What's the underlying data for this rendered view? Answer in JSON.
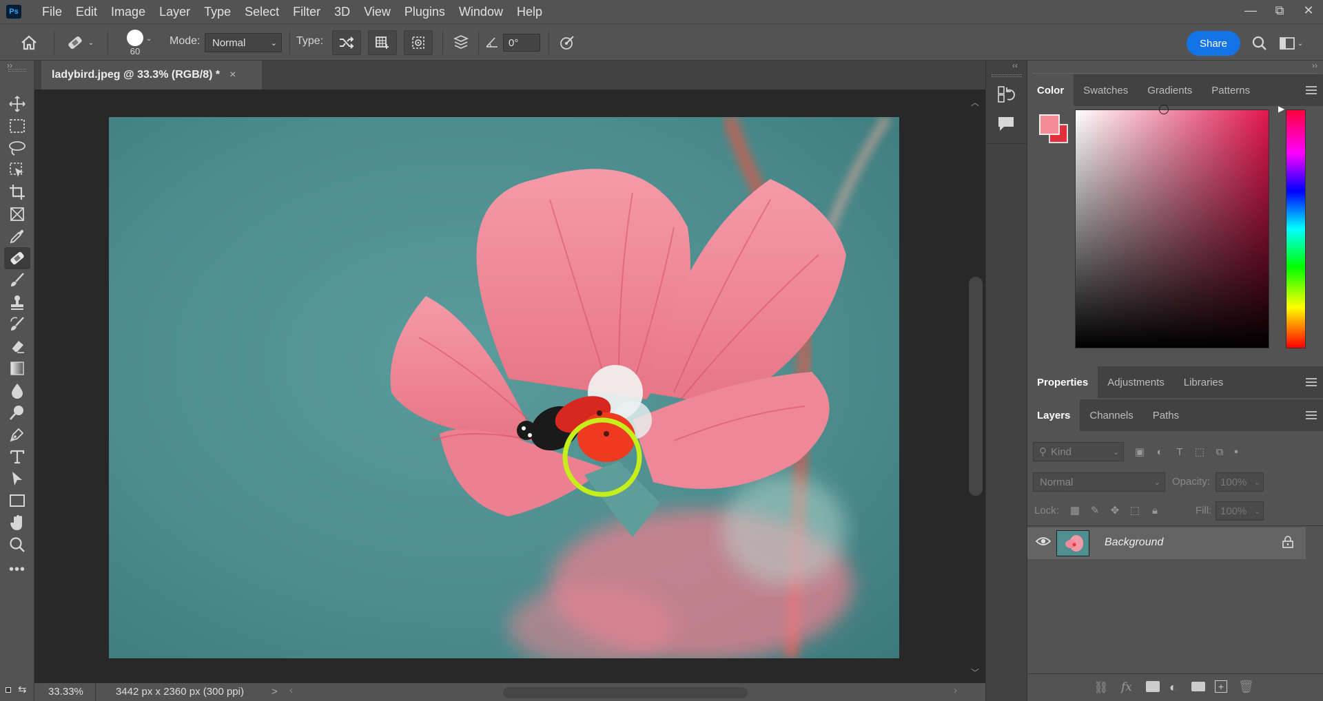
{
  "app": {
    "logo_text": "Ps"
  },
  "menu": [
    "File",
    "Edit",
    "Image",
    "Layer",
    "Type",
    "Select",
    "Filter",
    "3D",
    "View",
    "Plugins",
    "Window",
    "Help"
  ],
  "window_controls": {
    "minimize": "—",
    "restore": "⧉",
    "close": "✕"
  },
  "options": {
    "brush_size": "60",
    "mode_label": "Mode:",
    "mode_value": "Normal",
    "type_label": "Type:",
    "angle_value": "0°",
    "share_label": "Share"
  },
  "document": {
    "tab_title": "ladybird.jpeg @ 33.3% (RGB/8) *",
    "close_glyph": "×",
    "zoom": "33.33%",
    "doc_info": "3442 px x 2360 px (300 ppi)",
    "status_arrow": ">"
  },
  "colors": {
    "foreground": "#f48c98",
    "background": "#e0303c",
    "accent": "#1473e6",
    "brush_cursor": "#c6ee1a"
  },
  "color_panel": {
    "tabs": [
      "Color",
      "Swatches",
      "Gradients",
      "Patterns"
    ],
    "active_tab": "Color"
  },
  "properties_panel": {
    "tabs": [
      "Properties",
      "Adjustments",
      "Libraries"
    ],
    "active_tab": "Properties"
  },
  "layers_panel": {
    "tabs": [
      "Layers",
      "Channels",
      "Paths"
    ],
    "active_tab": "Layers",
    "filter_placeholder": "Kind",
    "blend_mode": "Normal",
    "opacity_label": "Opacity:",
    "opacity_value": "100%",
    "lock_label": "Lock:",
    "fill_label": "Fill:",
    "fill_value": "100%",
    "layers": [
      {
        "name": "Background",
        "visible": true,
        "locked": true
      }
    ],
    "footer_icons": [
      "link-icon",
      "fx-icon",
      "mask-icon",
      "adjustment-icon",
      "folder-icon",
      "new-layer-icon",
      "trash-icon"
    ]
  },
  "tools": [
    "move-tool",
    "marquee-tool",
    "lasso-tool",
    "object-selection-tool",
    "crop-tool",
    "frame-tool",
    "eyedropper-tool",
    "healing-brush-tool",
    "brush-tool",
    "stamp-tool",
    "history-brush-tool",
    "eraser-tool",
    "gradient-tool",
    "blur-tool",
    "dodge-tool",
    "pen-tool",
    "type-tool",
    "path-selection-tool",
    "rectangle-tool",
    "hand-tool",
    "zoom-tool",
    "more-tools"
  ]
}
